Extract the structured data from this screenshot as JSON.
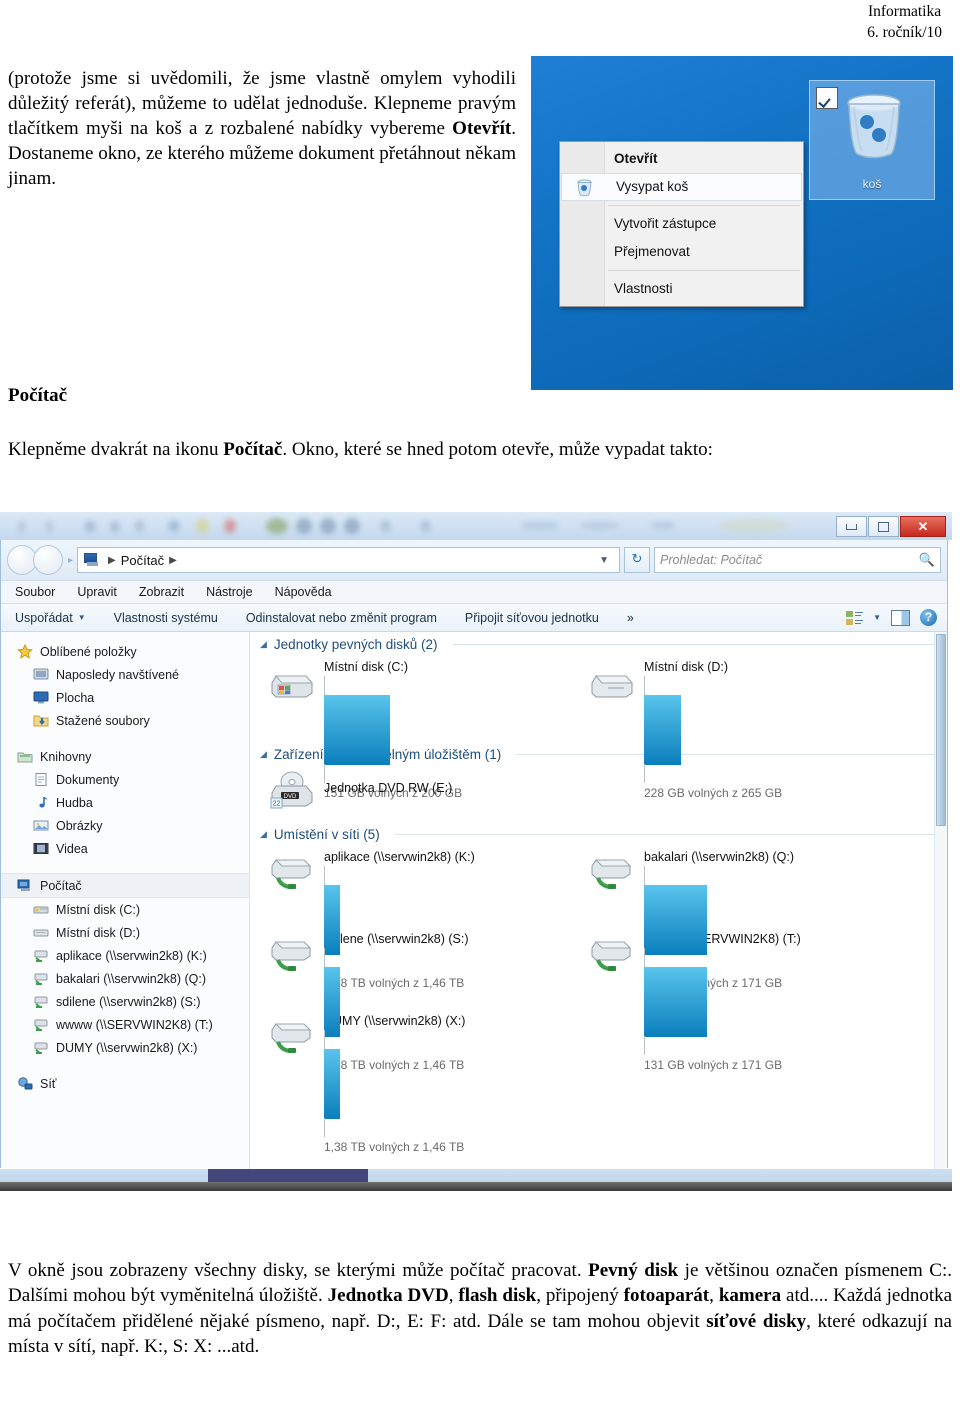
{
  "page_header": {
    "subject": "Informatika",
    "grade_page": "6. ročník/10"
  },
  "body_text": {
    "paragraph_top_1": "(protože jsme si uvědomili, že jsme vlastně omylem vyhodili důležitý referát), můžeme to udělat jednoduše. Klepneme pravým tlačítkem myši na koš a z rozbalené nabídky vybereme ",
    "paragraph_top_bold": "Otevřít",
    "paragraph_top_2": ". Dostaneme okno, ze kterého můžeme dokument přetáhnout někam jinam.",
    "heading_pocitac": "Počítač",
    "paragraph_mid_1": "Klepněme dvakrát na ikonu ",
    "paragraph_mid_bold": "Počítač",
    "paragraph_mid_2": ". Okno, které se hned potom otevře, může vypadat takto:",
    "paragraph_bottom_1": "V okně jsou zobrazeny všechny disky, se kterými může počítač pracovat. ",
    "paragraph_bottom_b1": "Pevný disk",
    "paragraph_bottom_2": " je většinou označen písmenem C:. Dalšími mohou být vyměnitelná úložiště. ",
    "paragraph_bottom_b2": "Jednotka DVD",
    "paragraph_bottom_3": ", ",
    "paragraph_bottom_b3": "flash disk",
    "paragraph_bottom_4": ", připojený ",
    "paragraph_bottom_b4": "fotoaparát",
    "paragraph_bottom_5": ", ",
    "paragraph_bottom_b5": "kamera",
    "paragraph_bottom_6": " atd.... Každá jednotka má počítačem přidělené nějaké písmeno, např. D:, E: F: atd. Dále se tam mohou objevit ",
    "paragraph_bottom_b6": "síťové disky",
    "paragraph_bottom_7": ", které odkazují na místa v sítí, např. K:, S: X: ...atd."
  },
  "desktop_screenshot": {
    "recycle_bin_label": "koš",
    "recycle_bin_icon": "recycle-bin-icon",
    "checkbox_icon": "checkbox-checked-icon",
    "context_menu": [
      {
        "label": "Otevřít",
        "bold": true,
        "highlighted": false,
        "icon": ""
      },
      {
        "label": "Vysypat koš",
        "bold": false,
        "highlighted": true,
        "icon": "empty-bin-icon"
      },
      {
        "label": "Vytvořit zástupce",
        "bold": false,
        "highlighted": false,
        "icon": ""
      },
      {
        "label": "Přejmenovat",
        "bold": false,
        "highlighted": false,
        "icon": ""
      },
      {
        "label": "Vlastnosti",
        "bold": false,
        "highlighted": false,
        "icon": ""
      }
    ]
  },
  "explorer_window": {
    "window_controls": {
      "minimize": "minimize-icon",
      "maximize": "maximize-icon",
      "close": "✕"
    },
    "address_bar": {
      "crumb_icon": "computer-icon",
      "crumb": "Počítač",
      "dropdown_icon": "chevron-down-icon",
      "refresh_icon": "↻"
    },
    "search": {
      "placeholder": "Prohledat: Počítač",
      "icon": "search-icon"
    },
    "menu_bar": [
      "Soubor",
      "Upravit",
      "Zobrazit",
      "Nástroje",
      "Nápověda"
    ],
    "toolbar": {
      "organize": "Uspořádat",
      "system_properties": "Vlastnosti systému",
      "uninstall": "Odinstalovat nebo změnit program",
      "map_drive": "Připojit síťovou jednotku",
      "overflow": "»",
      "view_icon": "view-layout-icon",
      "pane_icon": "preview-pane-icon",
      "help_icon": "?"
    },
    "sidebar": [
      {
        "label": "Oblíbené položky",
        "icon": "star-icon",
        "level": 0,
        "selected": false
      },
      {
        "label": "Naposledy navštívené",
        "icon": "recent-places-icon",
        "level": 1,
        "selected": false
      },
      {
        "label": "Plocha",
        "icon": "desktop-icon",
        "level": 1,
        "selected": false
      },
      {
        "label": "Stažené soubory",
        "icon": "downloads-folder-icon",
        "level": 1,
        "selected": false
      },
      {
        "label": "Knihovny",
        "icon": "libraries-icon",
        "level": 0,
        "selected": false,
        "gap_before": true
      },
      {
        "label": "Dokumenty",
        "icon": "documents-icon",
        "level": 1,
        "selected": false
      },
      {
        "label": "Hudba",
        "icon": "music-note-icon",
        "level": 1,
        "selected": false
      },
      {
        "label": "Obrázky",
        "icon": "pictures-icon",
        "level": 1,
        "selected": false
      },
      {
        "label": "Videa",
        "icon": "video-icon",
        "level": 1,
        "selected": false
      },
      {
        "label": "Počítač",
        "icon": "computer-icon",
        "level": 0,
        "selected": true,
        "gap_before": true
      },
      {
        "label": "Místní disk (C:)",
        "icon": "system-drive-icon",
        "level": 1,
        "selected": false
      },
      {
        "label": "Místní disk (D:)",
        "icon": "hard-drive-icon",
        "level": 1,
        "selected": false
      },
      {
        "label": "aplikace (\\\\servwin2k8) (K:)",
        "icon": "network-drive-icon",
        "level": 1,
        "selected": false
      },
      {
        "label": "bakalari (\\\\servwin2k8) (Q:)",
        "icon": "network-drive-icon",
        "level": 1,
        "selected": false
      },
      {
        "label": "sdilene (\\\\servwin2k8) (S:)",
        "icon": "network-drive-icon",
        "level": 1,
        "selected": false
      },
      {
        "label": "wwww (\\\\SERVWIN2K8) (T:)",
        "icon": "network-drive-icon",
        "level": 1,
        "selected": false
      },
      {
        "label": "DUMY (\\\\servwin2k8) (X:)",
        "icon": "network-drive-icon",
        "level": 1,
        "selected": false
      },
      {
        "label": "Síť",
        "icon": "network-icon",
        "level": 0,
        "selected": false,
        "gap_before": true
      }
    ],
    "groups": [
      {
        "title": "Jednotky pevných disků (2)",
        "items": [
          {
            "name": "Místní disk (C:)",
            "free_text": "151 GB volných z 200 GB",
            "used_percent": 25,
            "icon": "system-drive-icon",
            "has_bar": true
          },
          {
            "name": "Místní disk (D:)",
            "free_text": "228 GB volných z 265 GB",
            "used_percent": 14,
            "icon": "hard-drive-icon",
            "has_bar": true
          }
        ]
      },
      {
        "title": "Zařízení s vyměnitelným úložištěm (1)",
        "items": [
          {
            "name": "Jednotka DVD RW (E:)",
            "free_text": "",
            "used_percent": 0,
            "icon": "dvd-drive-icon",
            "has_bar": false
          }
        ]
      },
      {
        "title": "Umístění v síti (5)",
        "items": [
          {
            "name": "aplikace (\\\\servwin2k8) (K:)",
            "free_text": "1,38 TB volných z 1,46 TB",
            "used_percent": 6,
            "icon": "network-drive-icon",
            "has_bar": true
          },
          {
            "name": "bakalari (\\\\servwin2k8) (Q:)",
            "free_text": "131 GB volných z 171 GB",
            "used_percent": 24,
            "icon": "network-drive-icon",
            "has_bar": true
          },
          {
            "name": "sdilene (\\\\servwin2k8) (S:)",
            "free_text": "1,38 TB volných z 1,46 TB",
            "used_percent": 6,
            "icon": "network-drive-icon",
            "has_bar": true
          },
          {
            "name": "wwww (\\\\SERVWIN2K8) (T:)",
            "free_text": "131 GB volných z 171 GB",
            "used_percent": 24,
            "icon": "network-drive-icon",
            "has_bar": true
          },
          {
            "name": "DUMY (\\\\servwin2k8) (X:)",
            "free_text": "1,38 TB volných z 1,46 TB",
            "used_percent": 6,
            "icon": "network-drive-icon",
            "has_bar": true
          }
        ]
      }
    ]
  }
}
